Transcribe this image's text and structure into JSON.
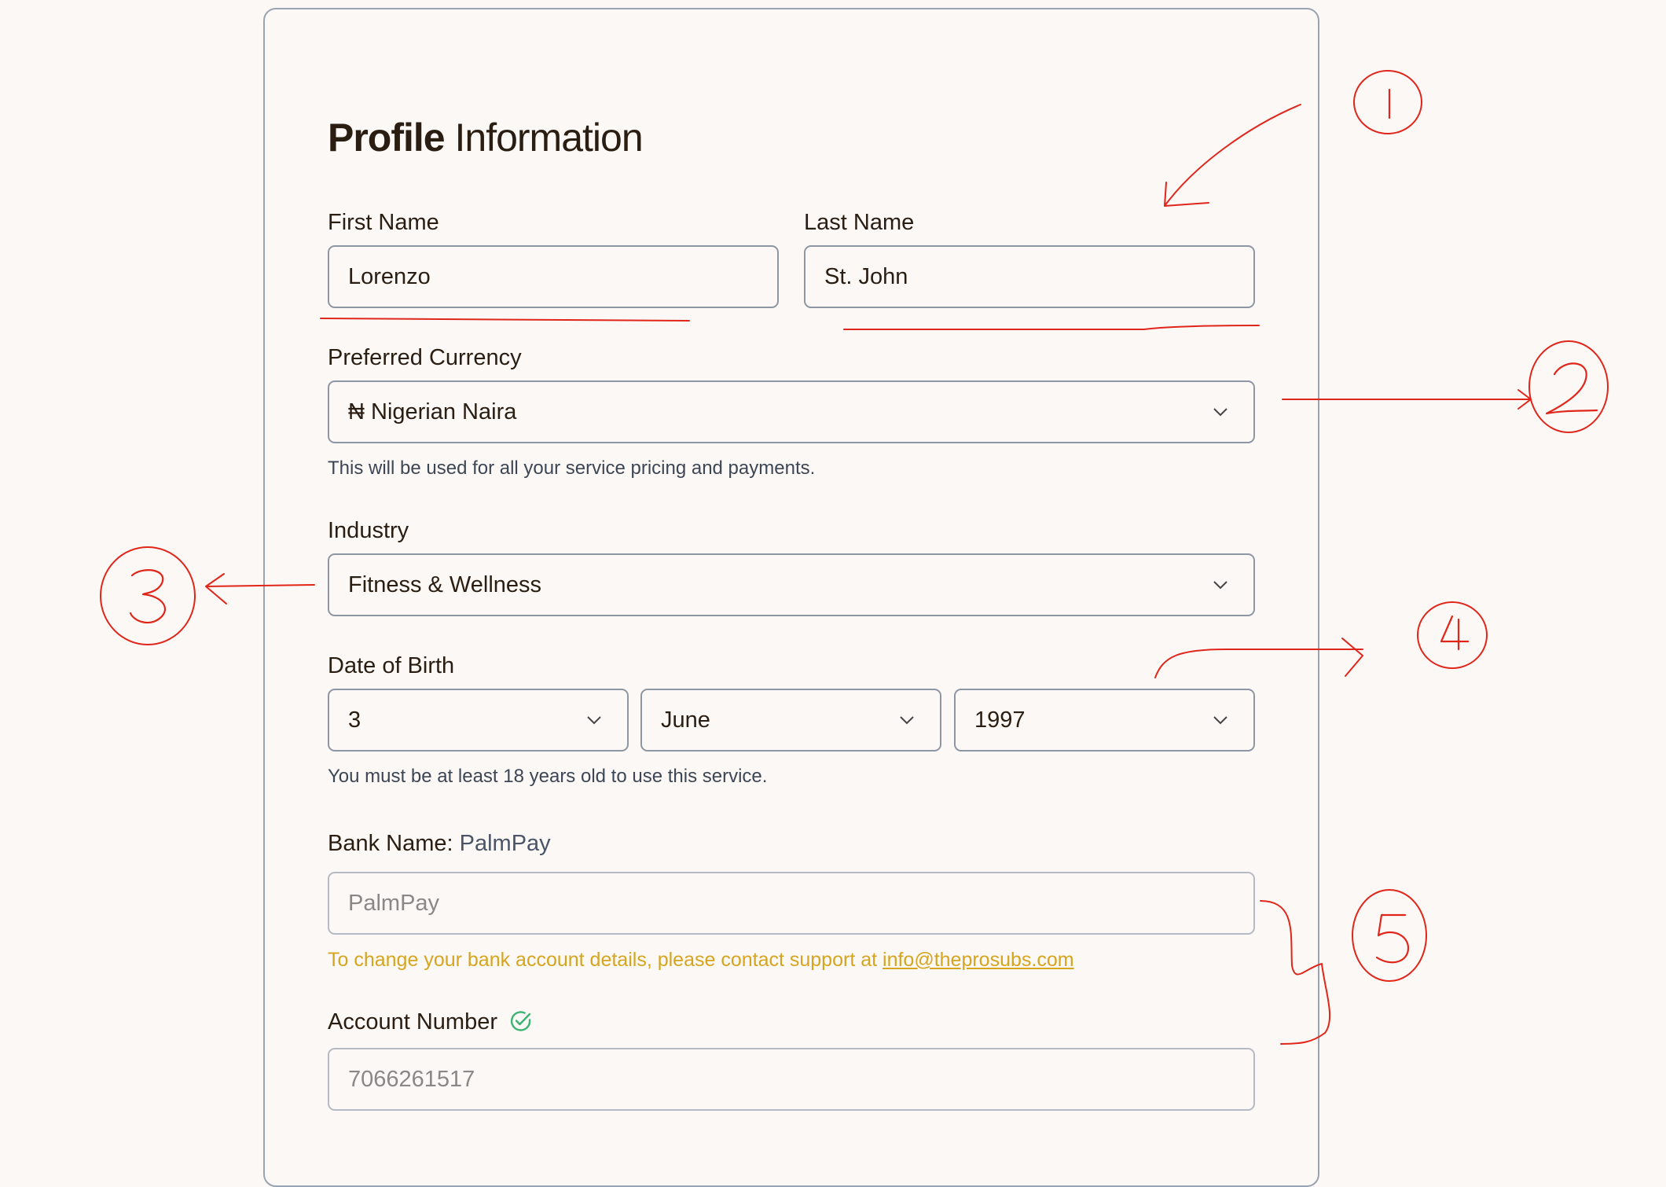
{
  "page": {
    "title_bold": "Profile",
    "title_rest": "Information"
  },
  "form": {
    "first_name": {
      "label": "First Name",
      "value": "Lorenzo"
    },
    "last_name": {
      "label": "Last Name",
      "value": "St. John"
    },
    "currency": {
      "label": "Preferred Currency",
      "value": "₦ Nigerian Naira",
      "help": "This will be used for all your service pricing and payments."
    },
    "industry": {
      "label": "Industry",
      "value": "Fitness & Wellness"
    },
    "dob": {
      "label": "Date of Birth",
      "day": "3",
      "month": "June",
      "year": "1997",
      "help": "You must be at least 18 years old to use this service."
    },
    "bank": {
      "label": "Bank Name",
      "separator": ":",
      "label_value": "PalmPay",
      "value": "PalmPay",
      "warning_prefix": "To change your bank account details, please contact support at ",
      "support_email": "info@theprosubs.com"
    },
    "account": {
      "label": "Account Number",
      "value": "7066261517",
      "verified_icon": "check-circle-icon"
    }
  },
  "colors": {
    "background": "#fcf8f5",
    "field_border": "#8e96a4",
    "warning": "#d6a51f",
    "verified": "#3cb371",
    "annotation": "#e0261b"
  },
  "annotations": {
    "numbers": [
      "1",
      "2",
      "3",
      "4",
      "5"
    ]
  }
}
